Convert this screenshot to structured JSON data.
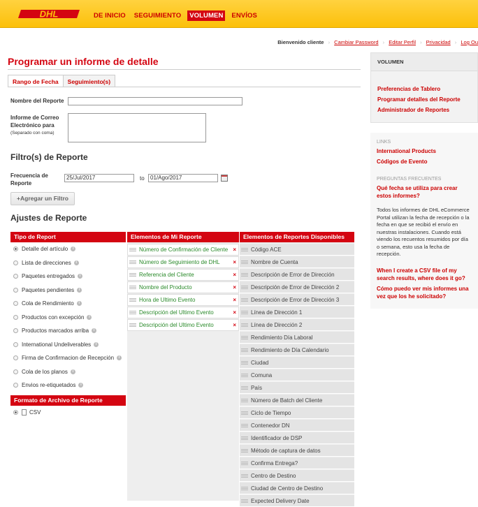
{
  "header": {
    "logo": "DHL",
    "nav": [
      "DE INICIO",
      "SEGUIMIENTO",
      "VOLUMEN",
      "ENVÍOS"
    ],
    "active_nav": "VOLUMEN",
    "brand_color": "#d40511",
    "bar_color": "#fcc00a"
  },
  "userbar": {
    "welcome": "Bienvenido cliente",
    "links": [
      "Cambiar Password",
      "Editar Perfil",
      "Privacidad",
      "Log Ou"
    ]
  },
  "page_title": "Programar un informe de detalle",
  "tabs": [
    "Rango de Fecha",
    "Seguimiento(s)"
  ],
  "form": {
    "report_name_label": "Nombre del Reporte",
    "report_name_value": "",
    "email_label": "Informe de Correo Electrónico para",
    "email_help": "(Separado con coma)",
    "email_value": "",
    "filters_title": "Filtro(s) de Reporte",
    "frequency_label": "Frecuencia de Reporte",
    "date_from": "25/Jul/2017",
    "to_label": "to",
    "date_to": "01/Ago/2017",
    "add_filter_button": "+Agregar un Filtro",
    "settings_title": "Ajustes de Reporte"
  },
  "columns": {
    "report_type_header": "Tipo de Report",
    "my_elements_header": "Elementos de Mi Reporte",
    "available_elements_header": "Elementos de Reportes Disponibles",
    "report_types": [
      {
        "label": "Detalle del artículo",
        "selected": true
      },
      {
        "label": "Lista de direcciones",
        "selected": false
      },
      {
        "label": "Paquetes entregados",
        "selected": false
      },
      {
        "label": "Paquetes pendientes",
        "selected": false
      },
      {
        "label": "Cola de Rendimiento",
        "selected": false
      },
      {
        "label": "Productos con excepción",
        "selected": false
      },
      {
        "label": "Productos marcados arriba",
        "selected": false
      },
      {
        "label": "International Undeliverables",
        "selected": false
      },
      {
        "label": "Firma de Confirmacion de Recepción",
        "selected": false
      },
      {
        "label": "Cola de los planos",
        "selected": false
      },
      {
        "label": "Envios re-etiquetados",
        "selected": false
      }
    ],
    "file_format_header": "Formato de Archivo de Reporte",
    "file_format": "CSV",
    "my_elements": [
      "Número de Confirmación de Cliente",
      "Número de Seguimiento de DHL",
      "Referencia del Cliente",
      "Nombre del Producto",
      "Hora de Ultimo Evento",
      "Descripción del Ultimo Evento",
      "Descripción del Ultimo Evento"
    ],
    "available_elements": [
      "Código ACE",
      "Nombre de Cuenta",
      "Descripción de Error de Dirección",
      "Descripción de Error de Dirección 2",
      "Descripción de Error de Dirección 3",
      "Línea de Dirección 1",
      "Línea de Dirección 2",
      "Rendimiento Día Laboral",
      "Rendimiento de Día Calendario",
      "Ciudad",
      "Comuna",
      "País",
      "Número de Batch del Cliente",
      "Ciclo de Tiempo",
      "Contenedor DN",
      "Identificador de DSP",
      "Método de captura de datos",
      "Confirma Entrega?",
      "Centro de Destino",
      "Ciudad de Centro de Destino",
      "Expected Delivery Date"
    ]
  },
  "sidebar": {
    "volumen_title": "VOLUMEN",
    "volumen_links": [
      "Preferencias de Tablero",
      "Programar detalles del Reporte",
      "Administrador de Reportes"
    ],
    "links_title": "LINKS",
    "links": [
      "International Products",
      "Códigos de Evento"
    ],
    "faq_title": "PREGUNTAS FRECUENTES",
    "faq_q1": "Qué fecha se utiliza para crear estos informes?",
    "faq_a1": "Todos los informes de DHL eCommerce Portal utilizan la fecha de recepción o la fecha en que se recibió el envío en nuestras instalaciones. Cuando está viendo los recuentos resumidos por día o semana, esto usa la fecha de recepción.",
    "faq_q2": "When I create a CSV file of my search results, where does it go?",
    "faq_q3": "Cómo puedo ver mis informes una vez que los he solicitado?"
  }
}
